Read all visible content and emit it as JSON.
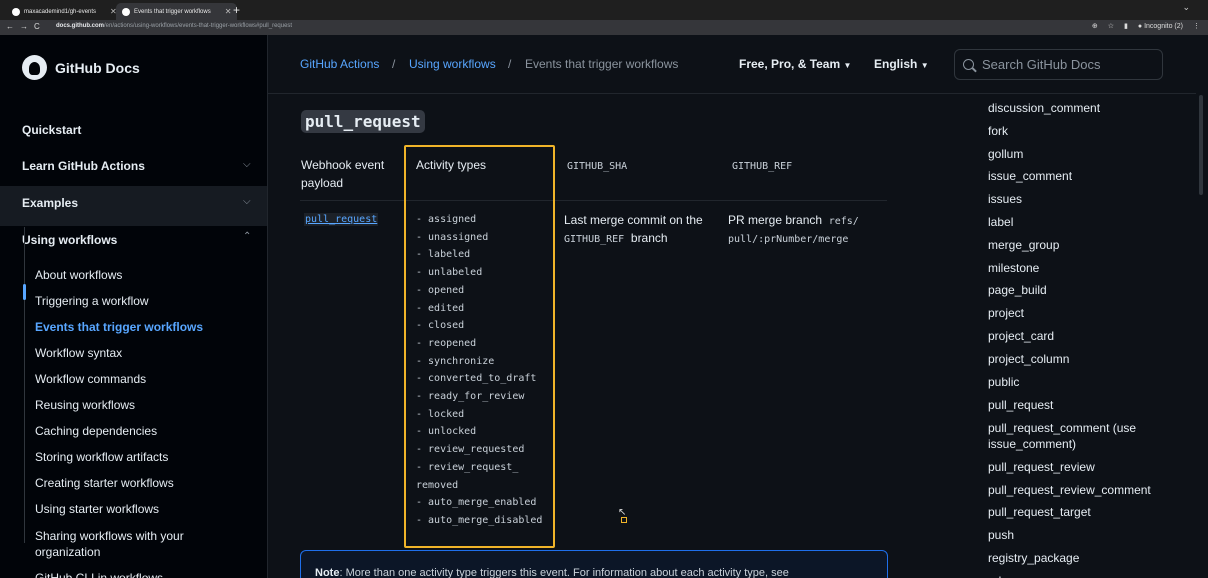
{
  "browser": {
    "tabs": [
      {
        "label": "maxacademind1/gh-events"
      },
      {
        "label": "Events that trigger workflows"
      }
    ],
    "new_tab": "+",
    "url_host": "docs.github.com",
    "url_path": "/en/actions/using-workflows/events-that-trigger-workflows#pull_request",
    "profile_label": "Incognito (2)"
  },
  "sidebar": {
    "logo_text": "GitHub Docs",
    "top_items": [
      {
        "label": "Quickstart"
      },
      {
        "label": "Learn GitHub Actions"
      },
      {
        "label": "Examples"
      },
      {
        "label": "Using workflows"
      }
    ],
    "sub_items": [
      {
        "label": "About workflows"
      },
      {
        "label": "Triggering a workflow"
      },
      {
        "label": "Events that trigger workflows"
      },
      {
        "label": "Workflow syntax"
      },
      {
        "label": "Workflow commands"
      },
      {
        "label": "Reusing workflows"
      },
      {
        "label": "Caching dependencies"
      },
      {
        "label": "Storing workflow artifacts"
      },
      {
        "label": "Creating starter workflows"
      },
      {
        "label": "Using starter workflows"
      },
      {
        "label": "Sharing workflows with your organization"
      },
      {
        "label": "GitHub CLI in workflows"
      }
    ]
  },
  "header": {
    "breadcrumb": [
      "GitHub Actions",
      "Using workflows",
      "Events that trigger workflows"
    ],
    "breadcrumb_sep": "/",
    "plan_dropdown": "Free, Pro, & Team",
    "language_dropdown": "English",
    "search_placeholder": "Search GitHub Docs"
  },
  "main": {
    "event_heading": "pull_request",
    "table_headers": [
      "Webhook event payload",
      "Activity types",
      "GITHUB_SHA",
      "GITHUB_REF"
    ],
    "payload_link": "pull_request",
    "activity_types": [
      "- assigned",
      "- unassigned",
      "- labeled",
      "- unlabeled",
      "- opened",
      "- edited",
      "- closed",
      "- reopened",
      "- synchronize",
      "- converted_to_draft",
      "- ready_for_review",
      "- locked",
      "- unlocked",
      "- review_requested",
      "- review_request_",
      "removed",
      "- auto_merge_enabled",
      "- auto_merge_disabled"
    ],
    "sha_text_1": "Last merge commit on the",
    "sha_code": "GITHUB_REF",
    "sha_text_2": "branch",
    "ref_text": "PR merge branch",
    "ref_code_1": "refs/",
    "ref_code_2": "pull/:prNumber/merge",
    "note_label": "Note",
    "note_text": ": More than one activity type triggers this event. For information about each activity type, see"
  },
  "toc": [
    "discussion_comment",
    "fork",
    "gollum",
    "issue_comment",
    "issues",
    "label",
    "merge_group",
    "milestone",
    "page_build",
    "project",
    "project_card",
    "project_column",
    "public",
    "pull_request",
    "pull_request_comment (use issue_comment)",
    "pull_request_review",
    "pull_request_review_comment",
    "pull_request_target",
    "push",
    "registry_package",
    "release"
  ],
  "colors": {
    "accent": "#58a6ff",
    "highlight_box": "#f0b429",
    "background": "#0d1117",
    "sidebar_bg": "#010409"
  }
}
